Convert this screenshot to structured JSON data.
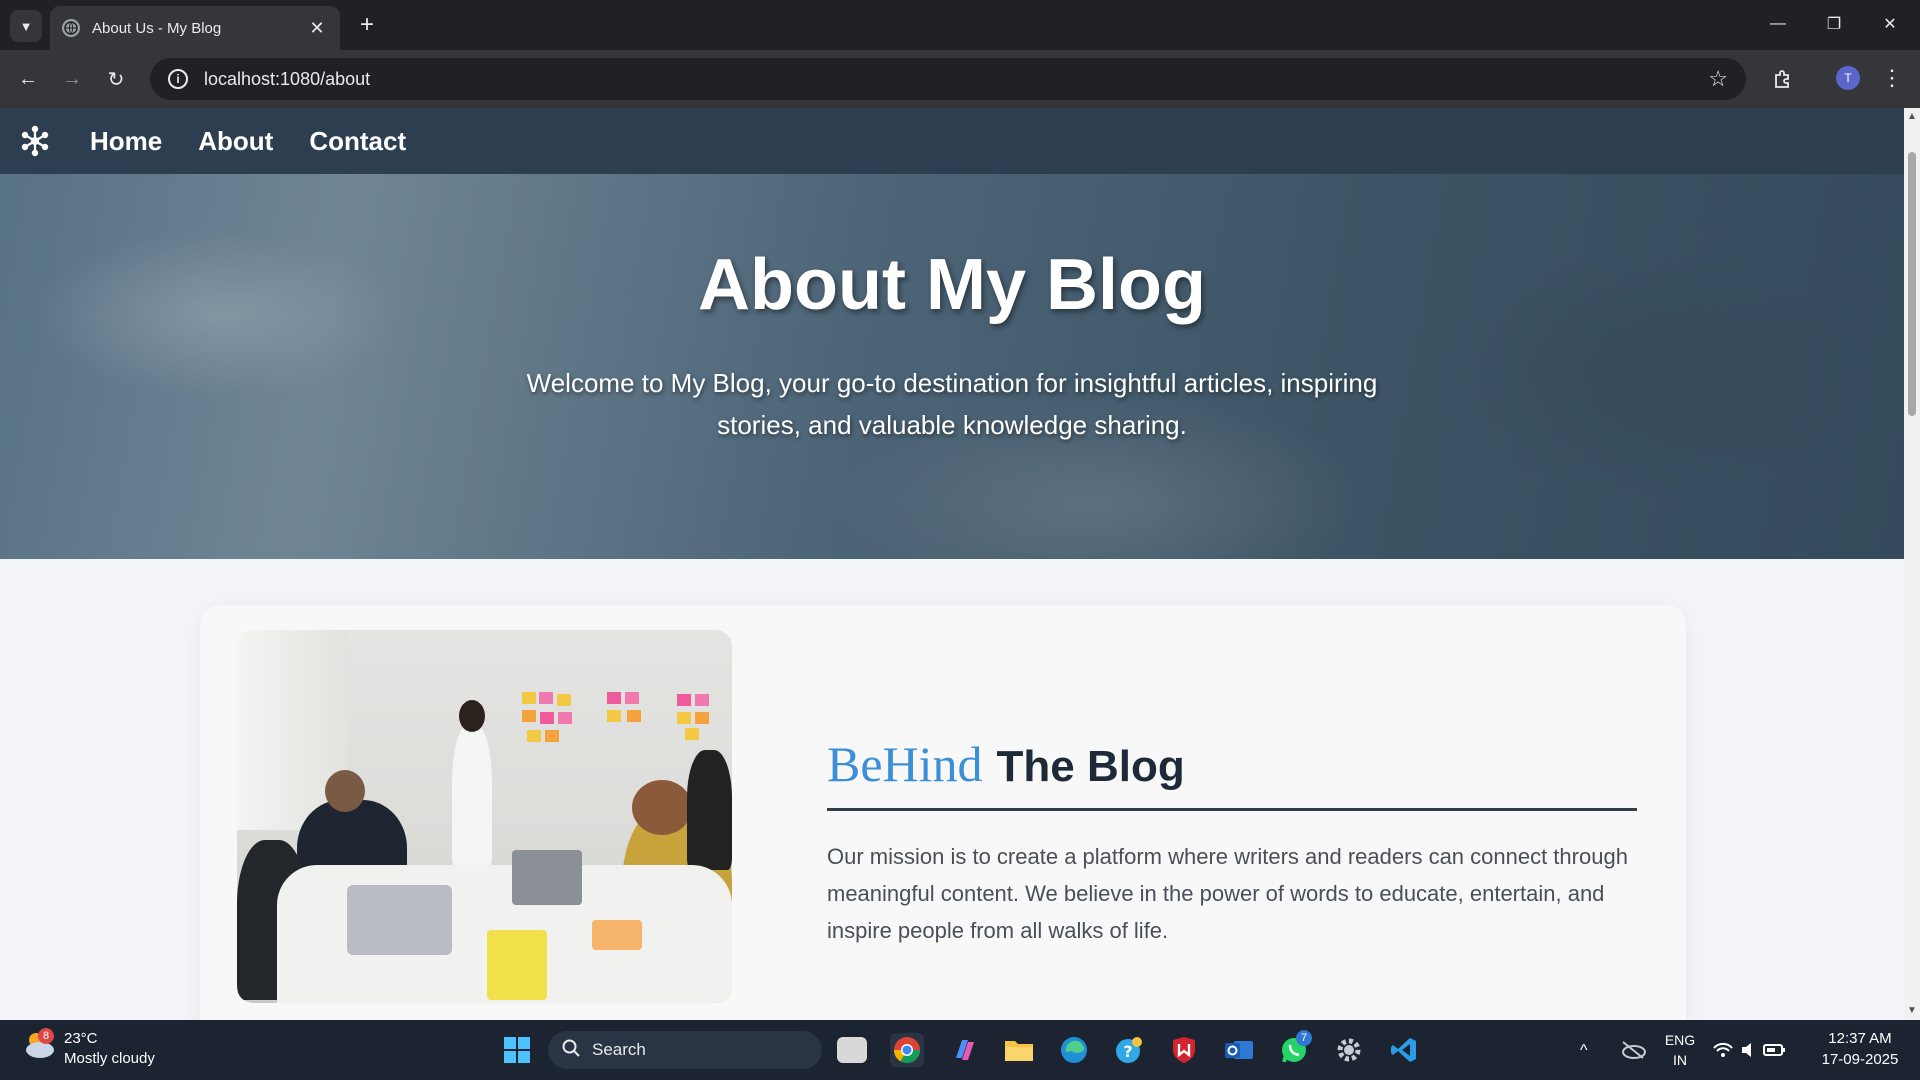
{
  "browser": {
    "tab_title": "About Us - My Blog",
    "url": "localhost:1080/about",
    "profile_initial": "T"
  },
  "site": {
    "nav": [
      {
        "label": "Home"
      },
      {
        "label": "About"
      },
      {
        "label": "Contact"
      }
    ],
    "hero_title": "About My Blog",
    "hero_subtitle": "Welcome to My Blog, your go-to destination for insightful articles, inspiring stories, and valuable knowledge sharing.",
    "section_heading_script": "BeHind",
    "section_heading_main": "The Blog",
    "mission_text": "Our mission is to create a platform where writers and readers can connect through meaningful content. We believe in the power of words to educate, entertain, and inspire people from all walks of life.",
    "colors": {
      "nav_bg": "#2c3e50",
      "accent": "#3a8fd6",
      "page_bg": "#f3f5f9"
    }
  },
  "taskbar": {
    "weather_temp": "23°C",
    "weather_desc": "Mostly cloudy",
    "weather_badge": "8",
    "search_label": "Search",
    "whatsapp_badge": "7",
    "lang_line1": "ENG",
    "lang_line2": "IN",
    "time": "12:37 AM",
    "date": "17-09-2025"
  }
}
